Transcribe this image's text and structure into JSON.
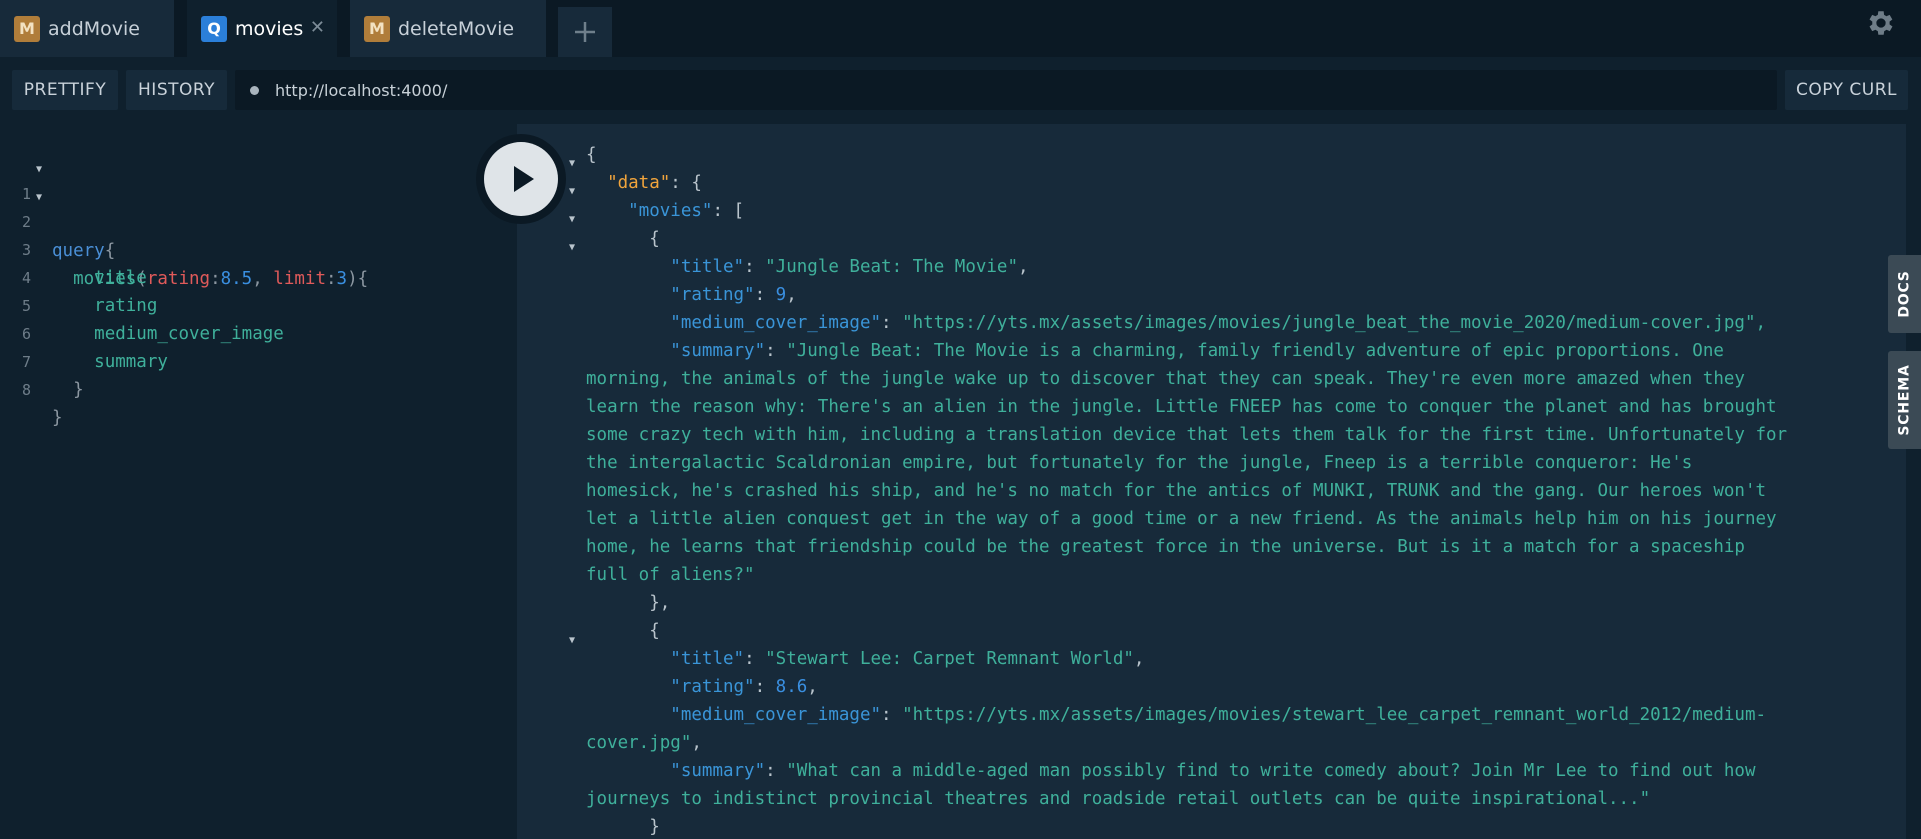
{
  "tabs": [
    {
      "badge": "M",
      "label": "addMovie"
    },
    {
      "badge": "Q",
      "label": "movies",
      "close": "✕"
    },
    {
      "badge": "M",
      "label": "deleteMovie"
    }
  ],
  "add_tab_icon": "plus-icon",
  "settings_icon": "gear-icon",
  "toolbar": {
    "prettify": "PRETTIFY",
    "history": "HISTORY",
    "url": "http://localhost:4000/",
    "copy_curl": "COPY CURL"
  },
  "side_tabs": {
    "docs": "DOCS",
    "schema": "SCHEMA"
  },
  "editor_lines": [
    {
      "n": "1",
      "fold": true
    },
    {
      "n": "2",
      "fold": true
    },
    {
      "n": "3"
    },
    {
      "n": "4"
    },
    {
      "n": "5"
    },
    {
      "n": "6"
    },
    {
      "n": "7"
    },
    {
      "n": "8"
    }
  ],
  "query": {
    "keyword": "query",
    "field": "movies",
    "arg1": "rating",
    "val1": "8.5",
    "arg2": "limit",
    "val2": "3",
    "fields": [
      "title",
      "rating",
      "medium_cover_image",
      "summary"
    ]
  },
  "result": {
    "data_key": "\"data\"",
    "movies_key": "\"movies\"",
    "movies": [
      {
        "title": "\"Jungle Beat: The Movie\"",
        "rating": "9",
        "medium_cover_image_lines": [
          "\"https://yts.mx/assets/images/movies/jungle_beat_the_movie_2020/medium-cover.jpg\","
        ],
        "summary_first": "\"Jungle Beat: The Movie is a charming, family friendly adventure of epic proportions. One",
        "summary_lines": [
          "morning, the animals of the jungle wake up to discover that they can speak. They're even more amazed when they",
          "learn the reason why: There's an alien in the jungle. Little FNEEP has come to conquer the planet and has brought",
          "some crazy tech with him, including a translation device that lets them talk for the first time. Unfortunately for",
          "the intergalactic Scaldronian empire, but fortunately for the jungle, Fneep is a terrible conqueror: He's",
          "homesick, he's crashed his ship, and he's no match for the antics of MUNKI, TRUNK and the gang. Our heroes won't",
          "let a little alien conquest get in the way of a good time or a new friend. As the animals help him on his journey",
          "home, he learns that friendship could be the greatest force in the universe. But is it a match for a spaceship",
          "full of aliens?\""
        ]
      },
      {
        "title": "\"Stewart Lee: Carpet Remnant World\"",
        "rating": "8.6",
        "medium_cover_image_first": "\"https://yts.mx/assets/images/movies/stewart_lee_carpet_remnant_world_2012/medium-",
        "medium_cover_image_rest": "cover.jpg\"",
        "summary_first": "\"What can a middle-aged man possibly find to write comedy about? Join Mr Lee to find out how",
        "summary_rest": "journeys to indistinct provincial theatres and roadside retail outlets can be quite inspirational...\""
      }
    ]
  },
  "result_keys": {
    "title": "\"title\"",
    "rating": "\"rating\"",
    "image": "\"medium_cover_image\"",
    "summary": "\"summary\""
  }
}
